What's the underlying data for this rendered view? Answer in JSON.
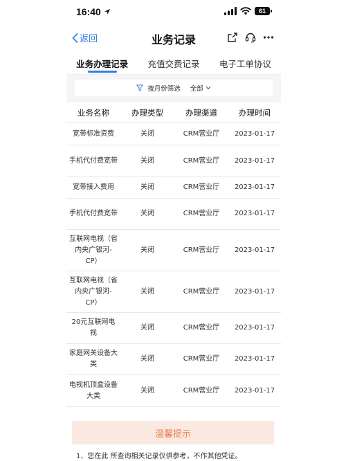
{
  "status_bar": {
    "time": "16:40",
    "battery": "61"
  },
  "nav": {
    "back_label": "返回",
    "title": "业务记录"
  },
  "tabs": [
    {
      "label": "业务办理记录",
      "active": true
    },
    {
      "label": "充值交费记录",
      "active": false
    },
    {
      "label": "电子工单协议",
      "active": false
    }
  ],
  "filter": {
    "month_label": "按月份筛选",
    "all_label": "全部"
  },
  "table": {
    "headers": [
      "业务名称",
      "办理类型",
      "办理渠道",
      "办理时间"
    ],
    "rows": [
      {
        "name": "宽带标准资费",
        "type": "关闭",
        "channel": "CRM营业厅",
        "time": "2023-01-17"
      },
      {
        "name": "手机代付费宽带",
        "type": "关闭",
        "channel": "CRM营业厅",
        "time": "2023-01-17"
      },
      {
        "name": "宽带接入费用",
        "type": "关闭",
        "channel": "CRM营业厅",
        "time": "2023-01-17"
      },
      {
        "name": "手机代付费宽带",
        "type": "关闭",
        "channel": "CRM营业厅",
        "time": "2023-01-17"
      },
      {
        "name": "互联网电视（省内央广银河-CP）",
        "type": "关闭",
        "channel": "CRM营业厅",
        "time": "2023-01-17"
      },
      {
        "name": "互联网电视（省内央广银河-CP）",
        "type": "关闭",
        "channel": "CRM营业厅",
        "time": "2023-01-17"
      },
      {
        "name": "20元互联网电视",
        "type": "关闭",
        "channel": "CRM营业厅",
        "time": "2023-01-17"
      },
      {
        "name": "家庭网关设备大类",
        "type": "关闭",
        "channel": "CRM营业厅",
        "time": "2023-01-17"
      },
      {
        "name": "电视机顶盒设备大类",
        "type": "关闭",
        "channel": "CRM营业厅",
        "time": "2023-01-17"
      }
    ]
  },
  "notice": {
    "title": "温馨提示",
    "line1": "1、您在此 所查询相关记录仅供参考，不作其他凭证。"
  },
  "colors": {
    "accent": "#2f7fe6",
    "notice_bg": "#fbe9e1",
    "notice_text": "#e9824f"
  }
}
